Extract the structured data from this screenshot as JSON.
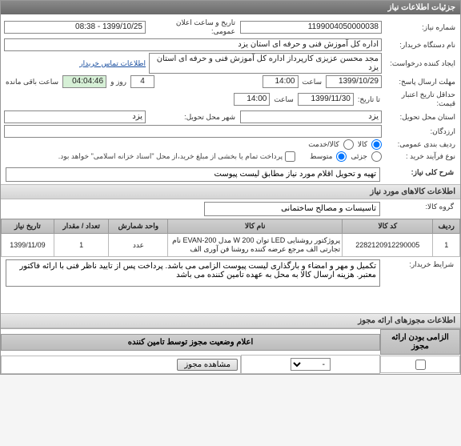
{
  "panel_title": "جزئیات اطلاعات نیاز",
  "labels": {
    "need_no": "شماره نیاز:",
    "announce_dt": "تاریخ و ساعت اعلان عمومی:",
    "buyer_org": "نام دستگاه خریدار:",
    "requester": "ایجاد کننده درخواست:",
    "contact": "اطلاعات تماس خریدار",
    "deadline": "مهلت ارسال پاسخ:",
    "hour": "ساعت",
    "and": "و",
    "day": "روز",
    "time_left": "ساعت باقی مانده",
    "price_valid": "حداقل تاریخ اعتبار قیمت:",
    "until": "تا تاریخ:",
    "delivery_prov": "استان محل تحویل:",
    "delivery_city": "شهر محل تحویل:",
    "suppliers": "ارزدگان:",
    "budget_row": "ردیف بندی عمومی:",
    "goods": "کالا",
    "service": "کالا/خدمت",
    "purchase_type": "نوع فرآیند خرید :",
    "small": "جزئی",
    "medium": "متوسط",
    "pay_note": "پرداخت تمام یا بخشی از مبلغ خرید،از محل \"اسناد خزانه اسلامی\" خواهد بود.",
    "need_desc": "شرح کلی نیاز:",
    "items_section": "اطلاعات کالاهای مورد نیاز",
    "goods_group": "گروه کالا:",
    "buyer_conditions": "شرایط خریدار:",
    "auth_section": "اطلاعات مجوزهای ارائه مجوز",
    "auth_announce": "اعلام وضعیت مجوز توسط تامین کننده",
    "auth_mandatory": "الزامی بودن ارائه مجوز",
    "view_license": "مشاهده مجوز"
  },
  "values": {
    "need_no": "1199004050000038",
    "announce_dt": "1399/10/25 - 08:38",
    "buyer_org": "اداره کل آموزش فنی و حرفه ای استان یزد",
    "requester": "مجد محسن عزیزی کارپرداز اداره کل آموزش فنی و حرفه ای استان یزد",
    "deadline_date": "1399/10/29",
    "deadline_time": "14:00",
    "countdown_days": "4",
    "countdown_time": "04:04:46",
    "price_valid_date": "1399/11/30",
    "price_valid_time": "14:00",
    "delivery_prov": "یزد",
    "delivery_city": "یزد",
    "need_desc": "تهیه و تحویل اقلام مورد نیاز مطابق لیست پیوست",
    "goods_group": "تاسیسات و مصالح ساختمانی",
    "buyer_conditions": "تکمیل و مهر و امضاء و بارگذاری لیست پیوست الزامی می باشد. پرداخت پس از تایید ناظر فنی با ارائه فاکتور معتبر. هزینه ارسال کالا به محل به عهده تامین کننده می باشد"
  },
  "table": {
    "headers": [
      "ردیف",
      "کد کالا",
      "نام کالا",
      "واحد شمارش",
      "تعداد / مقدار",
      "تاریخ نیاز"
    ],
    "rows": [
      {
        "idx": "1",
        "code": "2282120912290005",
        "name": "پروژکتور روشنایی LED توان W 200 مدل EVAN-200 نام تجارتی الف مرجع عرضه کننده روشنا فن آوری الف",
        "unit": "عدد",
        "qty": "1",
        "date": "1399/11/09"
      }
    ]
  },
  "auth_select": "-"
}
